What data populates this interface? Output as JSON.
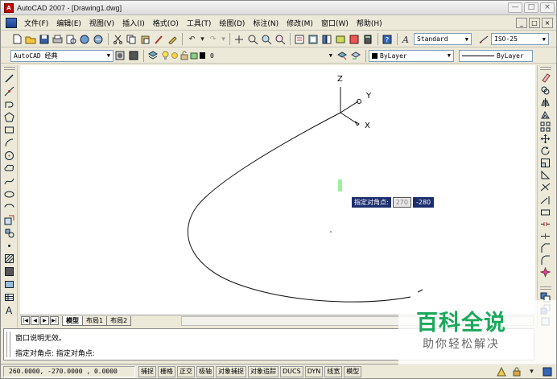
{
  "window": {
    "title": "AutoCAD 2007 - [Drawing1.dwg]",
    "controls": [
      "—",
      "□",
      "×"
    ]
  },
  "menubar": {
    "items": [
      "文件(F)",
      "编辑(E)",
      "视图(V)",
      "插入(I)",
      "格式(O)",
      "工具(T)",
      "绘图(D)",
      "标注(N)",
      "修改(M)",
      "窗口(W)",
      "帮助(H)"
    ],
    "mdi_controls": [
      "_",
      "□",
      "×"
    ]
  },
  "toolbar_standard": {
    "text_style": "Standard",
    "dim_style": "ISO-25"
  },
  "toolbar_layers": {
    "workspace": "AutoCAD 经典",
    "layer": "0",
    "color": "ByLayer",
    "linetype": "ByLayer"
  },
  "canvas": {
    "ucs": {
      "z_label": "Z",
      "y_label": "Y",
      "x_label": "X"
    },
    "dynamic_input": {
      "prompt": "指定对角点:",
      "x_value": "270",
      "y_value": "-280"
    }
  },
  "layout_tabs": {
    "nav": [
      "|◀",
      "◀",
      "▶",
      "▶|"
    ],
    "tabs": [
      "模型",
      "布局1",
      "布局2"
    ],
    "active": "模型"
  },
  "command": {
    "history": "窗口说明无效。",
    "prompt": "指定对角点: 指定对角点:"
  },
  "status_bar": {
    "coordinates": "260.0000,  -270.0000 ,  0.0000",
    "toggles": [
      "捕捉",
      "栅格",
      "正交",
      "极轴",
      "对象捕捉",
      "对象追踪",
      "DUCS",
      "DYN",
      "线宽",
      "模型"
    ]
  },
  "watermark": {
    "main": "百科全说",
    "sub": "助你轻松解决"
  },
  "colors": {
    "accent": "#1d2e6e",
    "watermark_green": "#1aa95c",
    "background": "#ece9d8"
  }
}
